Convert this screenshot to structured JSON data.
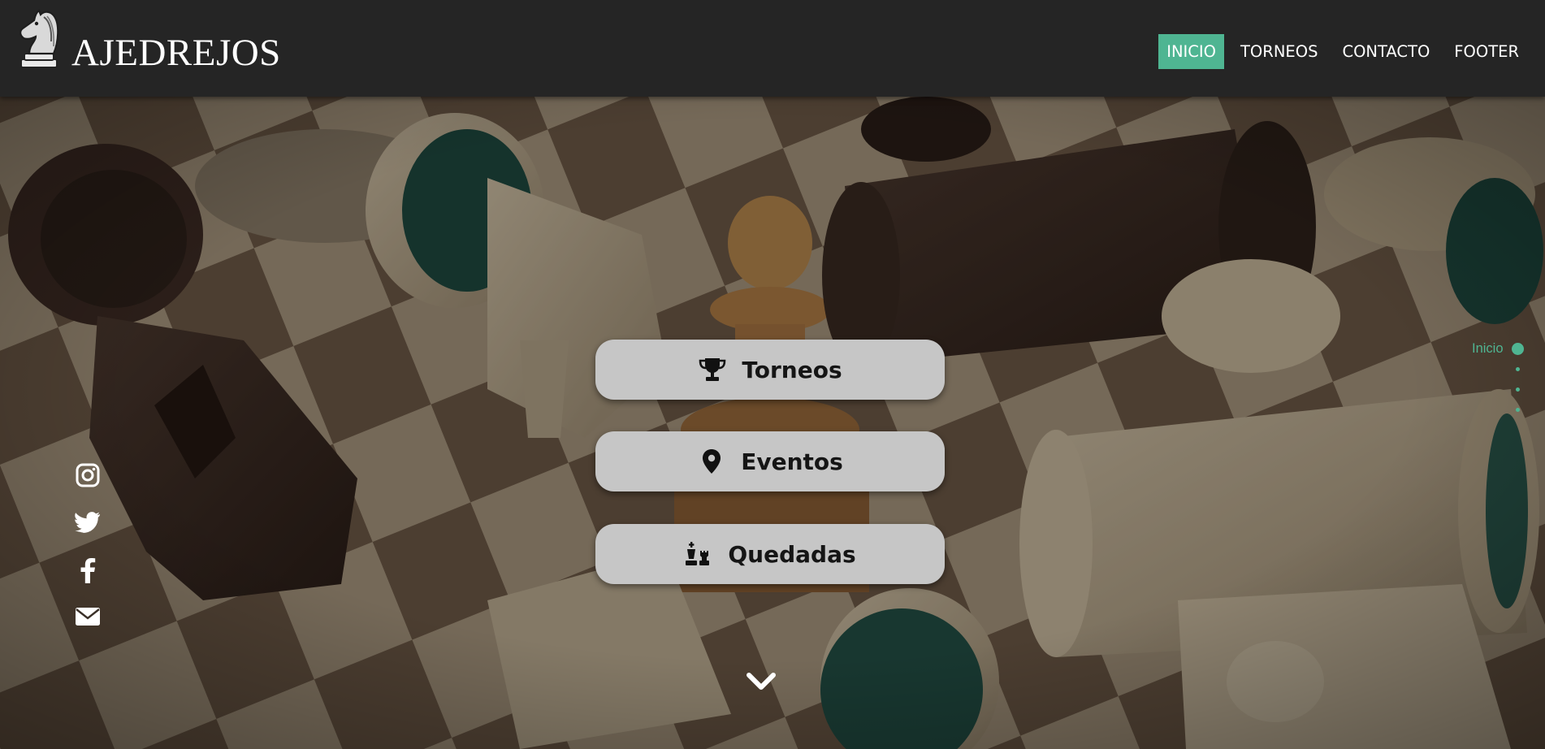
{
  "brand": {
    "name": "AJEDREJOS"
  },
  "nav": {
    "items": [
      {
        "label": "INICIO",
        "active": true
      },
      {
        "label": "TORNEOS",
        "active": false
      },
      {
        "label": "CONTACTO",
        "active": false
      },
      {
        "label": "FOOTER",
        "active": false
      }
    ]
  },
  "hero": {
    "buttons": [
      {
        "label": "Torneos",
        "icon": "trophy-icon"
      },
      {
        "label": "Eventos",
        "icon": "map-marker-icon"
      },
      {
        "label": "Quedadas",
        "icon": "chess-pieces-icon"
      }
    ],
    "scroll_icon": "chevron-down-icon"
  },
  "social": [
    "instagram-icon",
    "twitter-icon",
    "facebook-icon",
    "envelope-icon"
  ],
  "section_nav": {
    "label": "Inicio"
  },
  "colors": {
    "accent": "#4fb592",
    "header_bg": "#252525",
    "button_bg": "#c6c6c6"
  }
}
